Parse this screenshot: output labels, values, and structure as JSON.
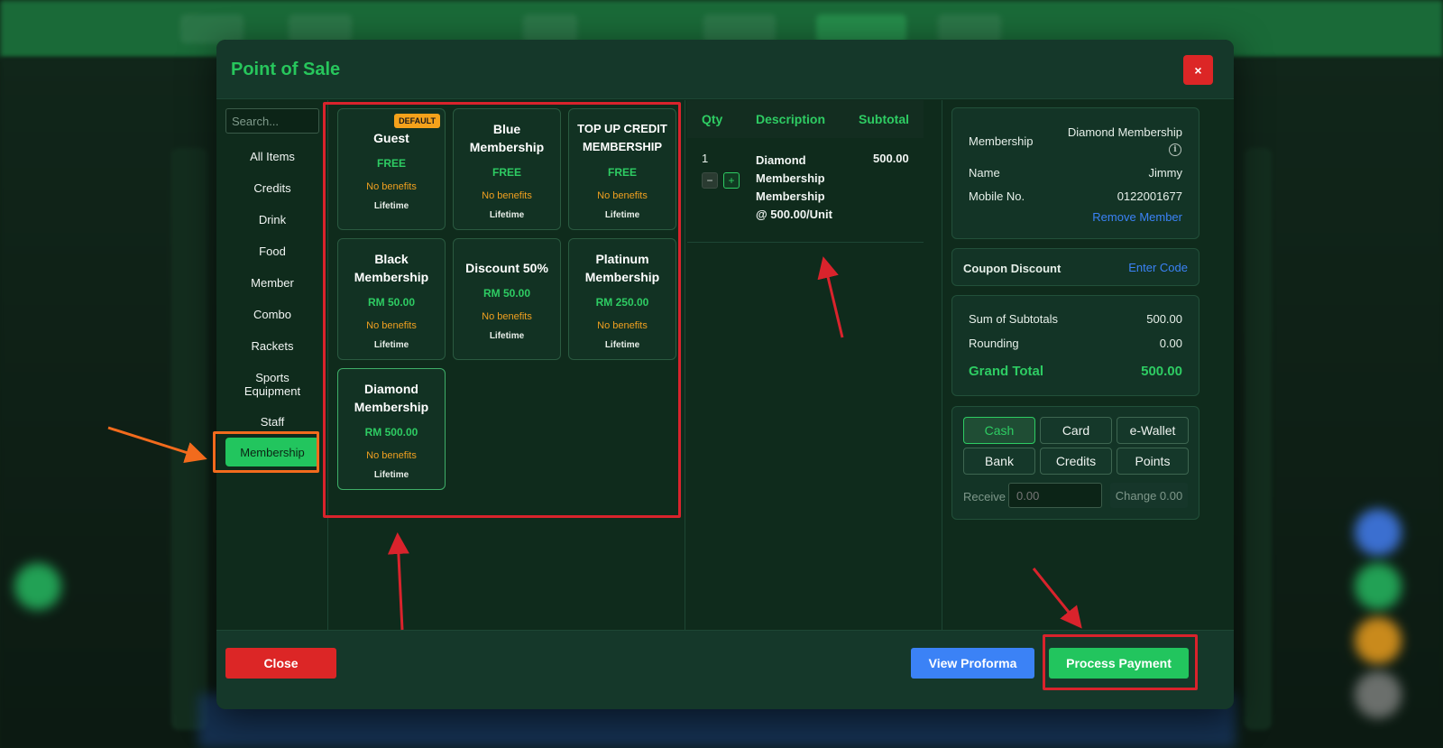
{
  "modal": {
    "title": "Point of Sale",
    "close_x": "×"
  },
  "categories": {
    "search_placeholder": "Search...",
    "items": [
      "All Items",
      "Credits",
      "Drink",
      "Food",
      "Member",
      "Combo",
      "Rackets",
      "Sports Equipment",
      "Staff"
    ],
    "active": "Membership"
  },
  "products": [
    {
      "name": "Guest",
      "price": "FREE",
      "benefit": "No benefits",
      "duration": "Lifetime",
      "badge": "DEFAULT"
    },
    {
      "name": "Blue Membership",
      "price": "FREE",
      "benefit": "No benefits",
      "duration": "Lifetime"
    },
    {
      "name": "TOP UP CREDIT MEMBERSHIP",
      "price": "FREE",
      "benefit": "No benefits",
      "duration": "Lifetime"
    },
    {
      "name": "Black Membership",
      "price": "RM 50.00",
      "benefit": "No benefits",
      "duration": "Lifetime"
    },
    {
      "name": "Discount 50%",
      "price": "RM 50.00",
      "benefit": "No benefits",
      "duration": "Lifetime"
    },
    {
      "name": "Platinum Membership",
      "price": "RM 250.00",
      "benefit": "No benefits",
      "duration": "Lifetime"
    },
    {
      "name": "Diamond Membership",
      "price": "RM 500.00",
      "benefit": "No benefits",
      "duration": "Lifetime"
    }
  ],
  "cart": {
    "headers": {
      "qty": "Qty",
      "description": "Description",
      "subtotal": "Subtotal"
    },
    "items": [
      {
        "qty": "1",
        "description": "Diamond Membership Membership @ 500.00/Unit",
        "subtotal": "500.00",
        "minus": "−",
        "plus": "+"
      }
    ]
  },
  "member": {
    "membership_label": "Membership",
    "membership_value": "Diamond Membership",
    "name_label": "Name",
    "name_value": "Jimmy",
    "mobile_label": "Mobile No.",
    "mobile_value": "0122001677",
    "remove_link": "Remove Member",
    "info_icon": "i"
  },
  "coupon": {
    "label": "Coupon Discount",
    "link": "Enter Code"
  },
  "totals": {
    "sum_label": "Sum of Subtotals",
    "sum_value": "500.00",
    "rounding_label": "Rounding",
    "rounding_value": "0.00",
    "grand_label": "Grand Total",
    "grand_value": "500.00"
  },
  "payment": {
    "methods": [
      "Cash",
      "Card",
      "e-Wallet",
      "Bank",
      "Credits",
      "Points"
    ],
    "active": "Cash",
    "receive_label": "Receive",
    "receive_placeholder": "0.00",
    "change_text": "Change 0.00"
  },
  "footer": {
    "close": "Close",
    "proforma": "View Proforma",
    "process": "Process Payment"
  },
  "colors": {
    "accent_green": "#22c55e",
    "danger_red": "#dc2626",
    "info_blue": "#3b82f6",
    "benefit_orange": "#f0a020",
    "annotation_red": "#d9232c",
    "annotation_orange": "#f26b1d"
  }
}
